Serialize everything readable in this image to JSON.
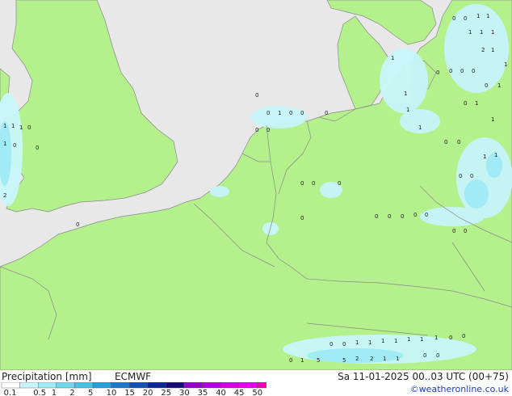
{
  "legend": {
    "title": "Precipitation [mm]",
    "model": "ECMWF",
    "datetime": "Sa 11-01-2025 00..03 UTC (00+75)",
    "credit": "©weatheronline.co.uk",
    "labels": [
      "0.1",
      "0.5",
      "1",
      "2",
      "5",
      "10",
      "15",
      "20",
      "25",
      "30",
      "35",
      "40",
      "45",
      "50"
    ],
    "colors": [
      "#ffffff",
      "#c8f5fa",
      "#a0ebf5",
      "#6ed7eb",
      "#46c3e1",
      "#28a0d7",
      "#1e78c8",
      "#1450b4",
      "#0a2896",
      "#1a0a78",
      "#9600c8",
      "#b400dc",
      "#d200e6",
      "#e600f0",
      "#f000b4"
    ]
  },
  "map_values": {
    "uk_west": [
      "1",
      "1",
      "1",
      "0",
      "1",
      "0",
      "0",
      "2",
      "0"
    ],
    "netherlands_coast": [
      "0",
      "0",
      "1",
      "0",
      "0",
      "0",
      "0",
      "0"
    ],
    "denmark": [
      "0",
      "0",
      "1",
      "1",
      "1",
      "1",
      "1",
      "2",
      "1",
      "1",
      "1",
      "0",
      "0",
      "0",
      "0",
      "0",
      "1",
      "0",
      "1"
    ],
    "germany_north": [
      "1",
      "1",
      "1",
      "1",
      "0",
      "0",
      "1",
      "1"
    ],
    "germany_central": [
      "0",
      "0",
      "0",
      "0",
      "0",
      "0",
      "0",
      "0",
      "0",
      "0",
      "0",
      "0",
      "0"
    ],
    "alps": [
      "0",
      "0",
      "1",
      "1",
      "1",
      "1",
      "1",
      "1",
      "1",
      "0",
      "0",
      "0",
      "1",
      "5",
      "5",
      "2",
      "2",
      "1",
      "1",
      "0",
      "0"
    ]
  }
}
